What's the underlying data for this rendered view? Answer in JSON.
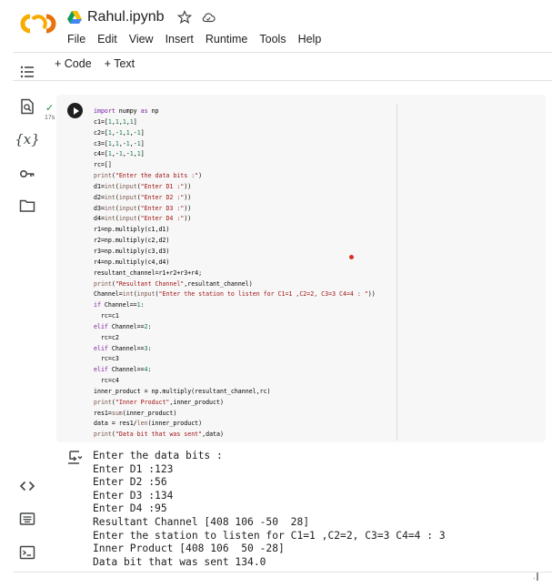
{
  "header": {
    "title": "Rahul.ipynb",
    "menu": [
      "File",
      "Edit",
      "View",
      "Insert",
      "Runtime",
      "Tools",
      "Help"
    ]
  },
  "toolbar": {
    "add_code": "+ Code",
    "add_text": "+ Text"
  },
  "rail": {
    "variables_label": "{x}"
  },
  "cell": {
    "status": "✓",
    "exec_time": "17s"
  },
  "output": {
    "lines": [
      "Enter the data bits :",
      "Enter D1 :123",
      "Enter D2 :56",
      "Enter D3 :134",
      "Enter D4 :95",
      "Resultant Channel [408 106 -50  28]",
      "Enter the station to listen for C1=1 ,C2=2, C3=3 C4=4 : 3",
      "Inner Product [408 106  50 -28]",
      "Data bit that was sent 134.0"
    ]
  },
  "colors": {
    "keyword": "#7b1fa2",
    "string": "#a31515",
    "number": "#0b8043",
    "run_button": "#1f1f1f",
    "success": "#1e8e3e",
    "marker": "#d93025"
  },
  "icons": [
    "colab-logo",
    "drive-icon",
    "star-icon",
    "cloud-icon",
    "toc-icon",
    "find-icon",
    "key-icon",
    "folder-icon",
    "code-snippets-icon",
    "command-palette-icon",
    "terminal-icon",
    "run-icon",
    "output-icon"
  ]
}
